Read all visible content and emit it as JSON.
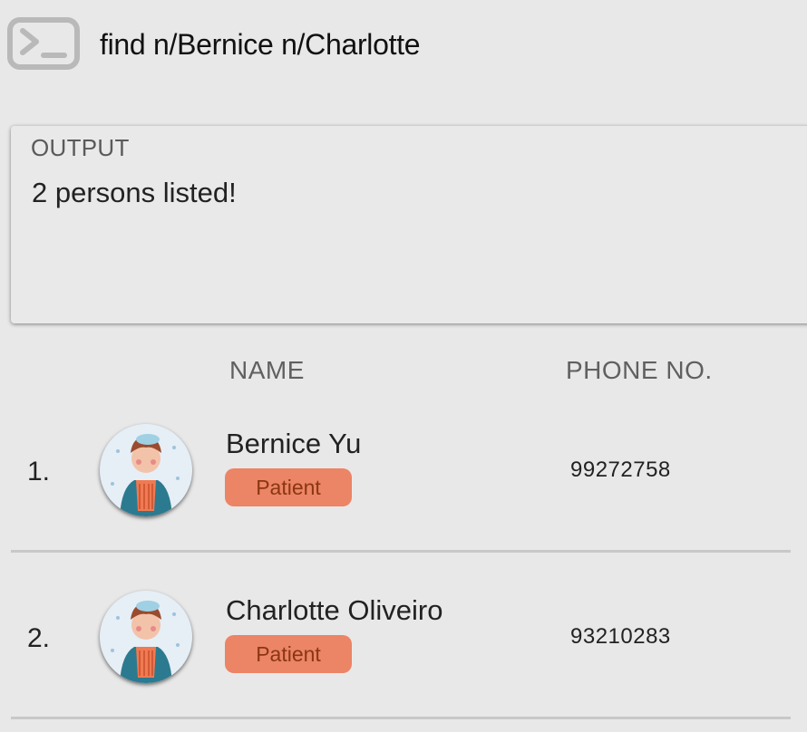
{
  "command": {
    "value": "find n/Bernice n/Charlotte",
    "icon": "terminal-icon"
  },
  "output": {
    "label": "OUTPUT",
    "message": "2 persons listed!"
  },
  "columns": {
    "name": "NAME",
    "phone": "PHONE NO."
  },
  "persons": [
    {
      "index": "1.",
      "name": "Bernice Yu",
      "tag": "Patient",
      "phone": "99272758"
    },
    {
      "index": "2.",
      "name": "Charlotte Oliveiro",
      "tag": "Patient",
      "phone": "93210283"
    }
  ],
  "colors": {
    "tag_bg": "#ec8466",
    "tag_text": "#8a3612",
    "background": "#e8e8e8"
  }
}
